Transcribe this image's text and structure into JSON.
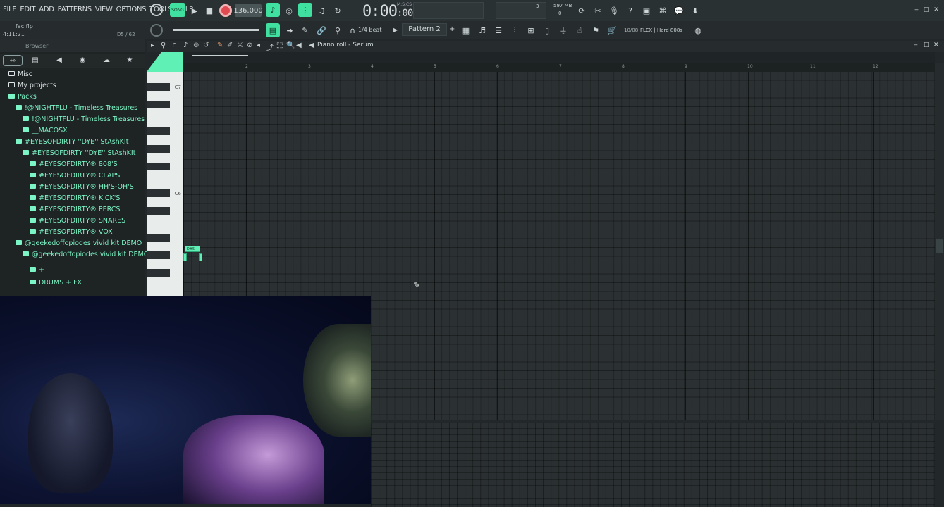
{
  "menu": [
    "FILE",
    "EDIT",
    "ADD",
    "PATTERNS",
    "VIEW",
    "OPTIONS",
    "TOOLS",
    "HELP"
  ],
  "transport": {
    "song_label": "SONG",
    "tempo": "136.000",
    "time": "0:00",
    "time_small": ":00",
    "time_units": "M:S:CS",
    "cpu_value": "3",
    "memory": "597 MB",
    "memory_sub": "0"
  },
  "project": {
    "file": "fac.flp",
    "time": "4:11:21",
    "pattern_pos": "D5 / 62"
  },
  "row2": {
    "snap": "1/4 beat",
    "pattern": "Pattern 2",
    "preset_count": "10/08",
    "preset_name": "FLEX | Hard 808s"
  },
  "browser": {
    "title": "Browser",
    "items": [
      {
        "label": "Misc",
        "type": "folder",
        "indent": 0
      },
      {
        "label": "My projects",
        "type": "folder",
        "indent": 0
      },
      {
        "label": "Packs",
        "type": "pack",
        "indent": 0
      },
      {
        "label": "!@NIGHTFLU - Timeless Treasures",
        "type": "pack",
        "indent": 1
      },
      {
        "label": "!@NIGHTFLU - Timeless Treasures",
        "type": "pack",
        "indent": 2
      },
      {
        "label": "__MACOSX",
        "type": "pack",
        "indent": 2
      },
      {
        "label": "#EYESOFDIRTY ''DYE'' StAshKIt",
        "type": "pack",
        "indent": 1
      },
      {
        "label": "#EYESOFDIRTY ''DYE'' StAshKIt",
        "type": "pack",
        "indent": 2
      },
      {
        "label": "#EYESOFDIRTY® 808'S",
        "type": "pack",
        "indent": 3
      },
      {
        "label": "#EYESOFDIRTY® CLAPS",
        "type": "pack",
        "indent": 3
      },
      {
        "label": "#EYESOFDIRTY® HH'S-OH'S",
        "type": "pack",
        "indent": 3
      },
      {
        "label": "#EYESOFDIRTY® KICK'S",
        "type": "pack",
        "indent": 3
      },
      {
        "label": "#EYESOFDIRTY® PERCS",
        "type": "pack",
        "indent": 3
      },
      {
        "label": "#EYESOFDIRTY® SNARES",
        "type": "pack",
        "indent": 3
      },
      {
        "label": "#EYESOFDIRTY® VOX",
        "type": "pack",
        "indent": 3
      },
      {
        "label": "@geekedoffopiodes vivid kit DEMO",
        "type": "pack",
        "indent": 1
      },
      {
        "label": "@geekedoffopiodes vivid kit DEMO",
        "type": "pack",
        "indent": 2
      },
      {
        "label": "+",
        "type": "pack",
        "indent": 3
      },
      {
        "label": "DRUMS + FX",
        "type": "pack",
        "indent": 3
      }
    ]
  },
  "piano_roll": {
    "title": "Piano roll - Serum",
    "ruler": [
      "2",
      "3",
      "4",
      "5",
      "6",
      "7",
      "8",
      "9",
      "10",
      "11",
      "12"
    ],
    "key_labels": [
      "C7",
      "C6"
    ],
    "note_label": "D#5"
  },
  "colors": {
    "accent": "#3fe0a0",
    "record": "#e04a50",
    "background": "#22282a"
  }
}
